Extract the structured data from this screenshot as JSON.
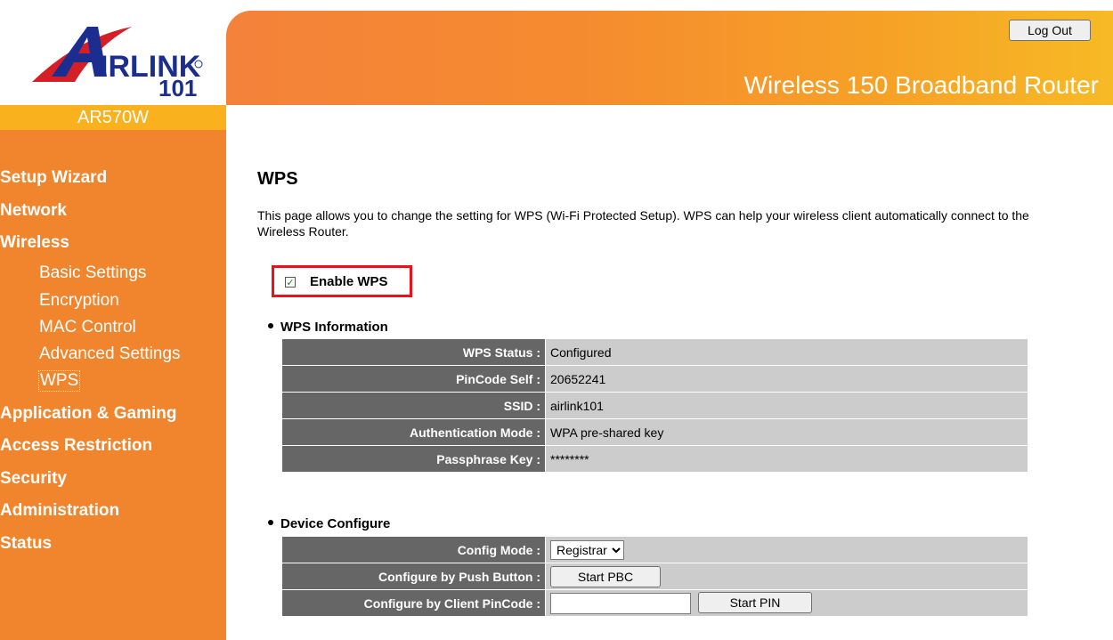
{
  "brand": {
    "logo_text": "AIRLINK 101",
    "model": "AR570W",
    "product_title": "Wireless 150 Broadband Router"
  },
  "header": {
    "logout_label": "Log Out"
  },
  "sidebar": {
    "main": [
      "Setup Wizard",
      "Network",
      "Wireless"
    ],
    "wireless_sub": [
      "Basic Settings",
      "Encryption",
      "MAC Control",
      "Advanced Settings",
      "WPS"
    ],
    "more": [
      "Application & Gaming",
      "Access Restriction",
      "Security",
      "Administration",
      "Status"
    ],
    "selected": "WPS"
  },
  "page": {
    "title": "WPS",
    "description": "This page allows you to change the setting for WPS (Wi-Fi Protected Setup). WPS can help your wireless client automatically connect to the Wireless Router.",
    "enable_label": "Enable WPS",
    "enable_checked": true
  },
  "wps_info": {
    "heading": "WPS Information",
    "rows": [
      {
        "label": "WPS Status :",
        "value": "Configured"
      },
      {
        "label": "PinCode Self :",
        "value": "20652241"
      },
      {
        "label": "SSID :",
        "value": "airlink101"
      },
      {
        "label": "Authentication Mode :",
        "value": "WPA pre-shared key"
      },
      {
        "label": "Passphrase Key :",
        "value": "********"
      }
    ]
  },
  "device_configure": {
    "heading": "Device Configure",
    "config_mode_label": "Config Mode :",
    "config_mode_value": "Registrar",
    "push_button_label": "Configure by Push Button :",
    "push_button_text": "Start PBC",
    "client_pin_label": "Configure by Client PinCode :",
    "client_pin_value": "",
    "client_pin_button": "Start PIN"
  },
  "colors": {
    "sidebar": "#f0852e",
    "model_bar": "#f9b21e",
    "label_cell": "#666666",
    "value_cell": "#cccccc",
    "highlight": "#e8121a"
  }
}
